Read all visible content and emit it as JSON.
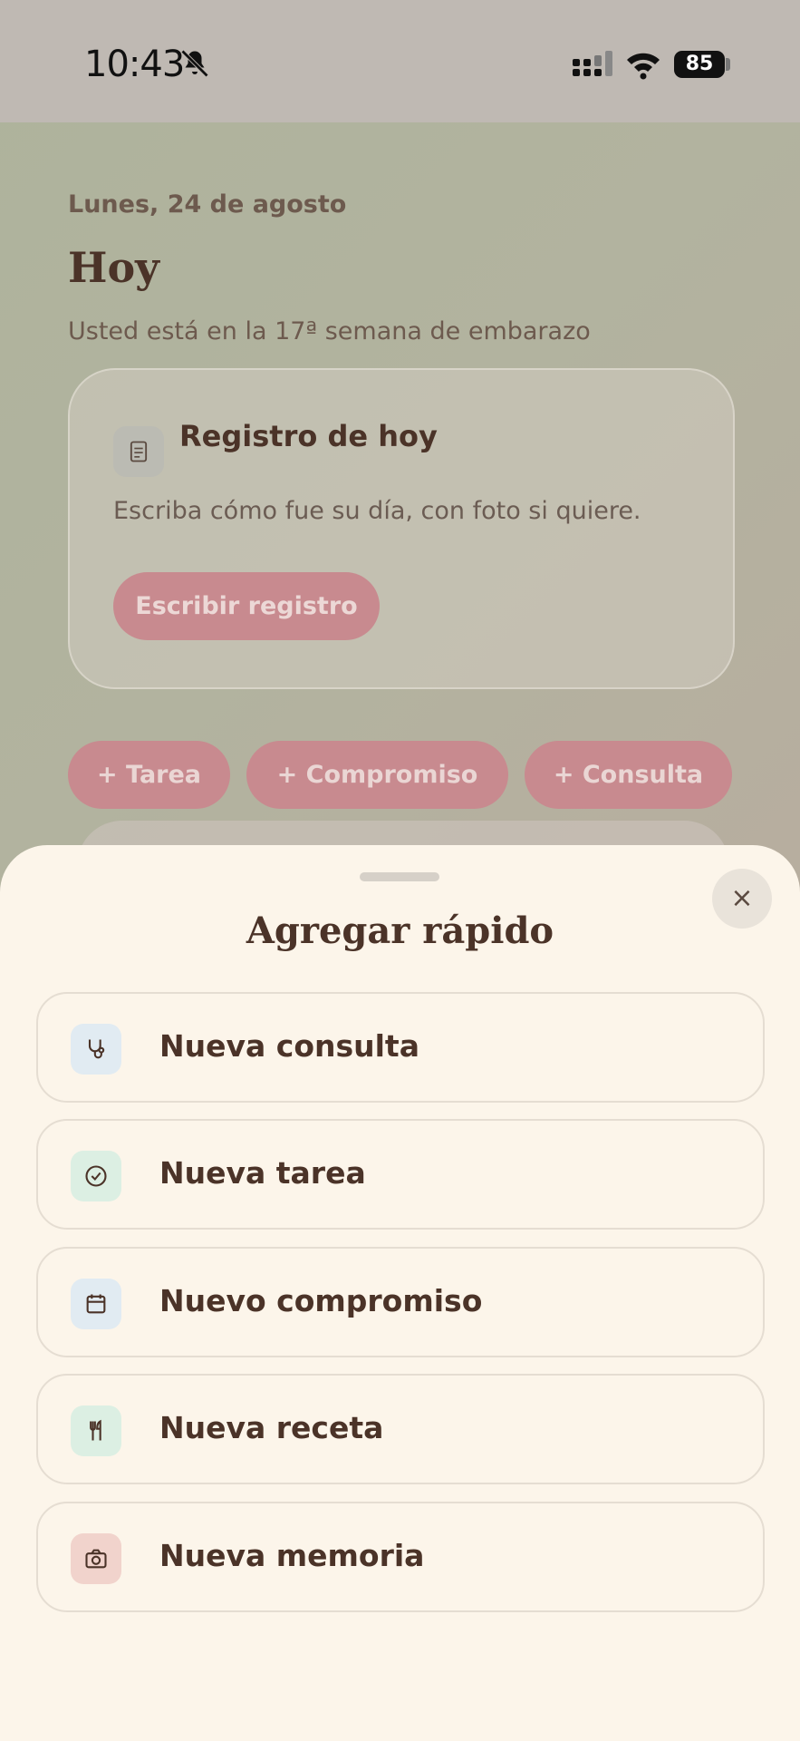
{
  "status_bar": {
    "time": "10:43",
    "battery": "85"
  },
  "background": {
    "date": "Lunes, 24 de agosto",
    "title": "Hoy",
    "week_text": "Usted está en la 17ª semana de embarazo",
    "card": {
      "title": "Registro de hoy",
      "description": "Escriba cómo fue su día, con foto si quiere.",
      "button": "Escribir registro"
    },
    "quick_pills": [
      "+ Tarea",
      "+ Compromiso",
      "+ Consulta"
    ]
  },
  "sheet": {
    "title": "Agregar rápido",
    "close_label": "×",
    "items": [
      {
        "label": "Nueva consulta",
        "icon": "stethoscope-icon",
        "icon_bg": "#e1ebf2"
      },
      {
        "label": "Nueva tarea",
        "icon": "check-circle-icon",
        "icon_bg": "#dcefe3"
      },
      {
        "label": "Nuevo compromiso",
        "icon": "calendar-icon",
        "icon_bg": "#e1ebf2"
      },
      {
        "label": "Nueva receta",
        "icon": "utensils-icon",
        "icon_bg": "#dcefe3"
      },
      {
        "label": "Nueva memoria",
        "icon": "camera-icon",
        "icon_bg": "#f1d3cc"
      }
    ]
  }
}
